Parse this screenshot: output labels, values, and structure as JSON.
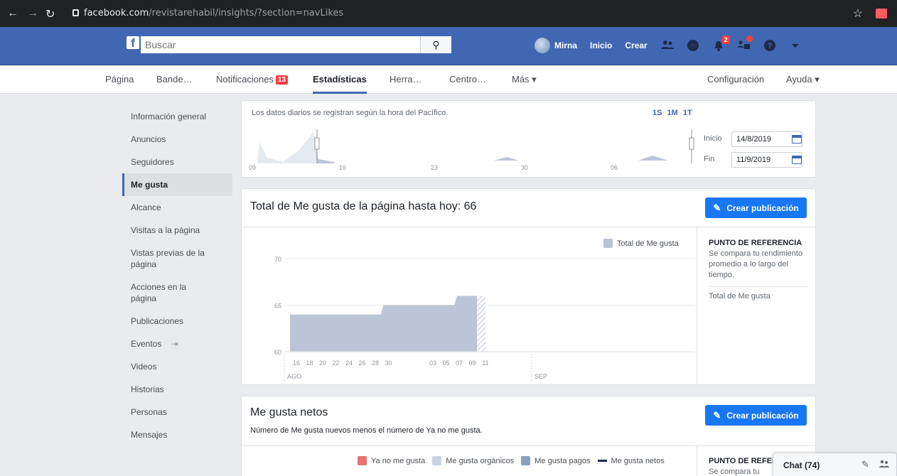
{
  "browser": {
    "url_domain": "facebook.com",
    "url_path": "/revistarehabil/insights/?section=navLikes"
  },
  "fbbar": {
    "search_placeholder": "Buscar",
    "user_name": "Mirna",
    "home_label": "Inicio",
    "create_label": "Crear",
    "notifications_badge": "2"
  },
  "tabs": {
    "pagina": "Página",
    "bandeja": "Bande…",
    "notificaciones": "Notificaciones",
    "notificaciones_badge": "13",
    "estadisticas": "Estadísticas",
    "herramientas": "Herra…",
    "centro": "Centro…",
    "mas": "Más ▾",
    "configuracion": "Configuración",
    "ayuda": "Ayuda ▾"
  },
  "sidebar": {
    "items": [
      {
        "label": "Información general"
      },
      {
        "label": "Anuncios"
      },
      {
        "label": "Seguidores"
      },
      {
        "label": "Me gusta"
      },
      {
        "label": "Alcance"
      },
      {
        "label": "Visitas a la página"
      },
      {
        "label": "Vistas previas de la página"
      },
      {
        "label": "Acciones en la página"
      },
      {
        "label": "Publicaciones"
      },
      {
        "label": "Eventos"
      },
      {
        "label": "Videos"
      },
      {
        "label": "Historias"
      },
      {
        "label": "Personas"
      },
      {
        "label": "Mensajes"
      }
    ]
  },
  "range": {
    "note": "Los datos diarios se registran según la hora del Pacífico.",
    "periods": "1S 1M 1T",
    "start_label": "Inicio",
    "start_date": "14/8/2019",
    "end_label": "Fin",
    "end_date": "11/9/2019",
    "ticks": [
      "09",
      "16",
      "23",
      "30",
      "06"
    ]
  },
  "likes_panel": {
    "title": "Total de Me gusta de la página hasta hoy: 66",
    "cta": "Crear publicación",
    "legend": "Total de Me gusta",
    "ref_title": "PUNTO DE REFERENCIA",
    "ref_desc": "Se compara tu rendimiento promedio a lo largo del tiempo.",
    "ref_metric": "Total de Me gusta"
  },
  "net_panel": {
    "title": "Me gusta netos",
    "subtitle": "Número de Me gusta nuevos menos el número de Ya no me gusta.",
    "cta": "Crear publicación",
    "legend": [
      "Ya no me gusta",
      "Me gusta orgánicos",
      "Me gusta pagos",
      "Me gusta netos"
    ],
    "ref_title": "PUNTO DE REFER",
    "ref_desc": "Se compara tu"
  },
  "chat": {
    "label": "Chat (74)"
  },
  "colors": {
    "fb_blue": "#4267b2",
    "cta_blue": "#1877f2",
    "area": "#bcc5d8",
    "badge": "#fa3e3e"
  },
  "chart_data": {
    "type": "area",
    "legend": [
      "Total de Me gusta"
    ],
    "x": [
      "14",
      "15",
      "16",
      "17",
      "18",
      "19",
      "20",
      "21",
      "22",
      "23",
      "24",
      "25",
      "26",
      "27",
      "28",
      "29",
      "30",
      "31",
      "01",
      "02",
      "03",
      "04",
      "05",
      "06",
      "07",
      "08",
      "09",
      "10",
      "11"
    ],
    "x_ticks": [
      "16",
      "18",
      "20",
      "22",
      "24",
      "26",
      "28",
      "30",
      "03",
      "05",
      "07",
      "09",
      "11"
    ],
    "x_group_labels": [
      "AGO",
      "SEP"
    ],
    "series": [
      {
        "name": "Total de Me gusta",
        "values": [
          64,
          64,
          64,
          64,
          64,
          64,
          64,
          64,
          64,
          64,
          64,
          64,
          64,
          64,
          65,
          65,
          65,
          65,
          65,
          65,
          65,
          65,
          65,
          65,
          65,
          66,
          66,
          66,
          66
        ]
      }
    ],
    "ylim": [
      60,
      70
    ],
    "y_ticks": [
      60,
      65,
      70
    ],
    "grid": true
  }
}
